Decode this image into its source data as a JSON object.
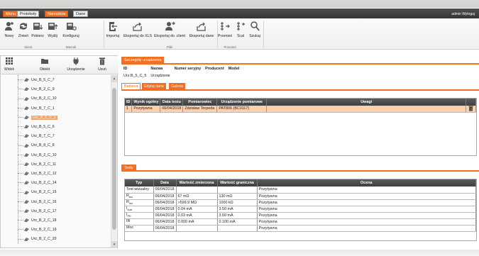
{
  "menubar": {
    "tabs": [
      {
        "label": "Menu",
        "active": true
      },
      {
        "label": "Protokoły",
        "active": false
      },
      {
        "label": "Narzędzia",
        "active": true
      },
      {
        "label": "Dane",
        "active": false
      }
    ],
    "admin_user": "admin",
    "logout": "Wyloguj"
  },
  "ribbon": {
    "buttons": {
      "nowy": "Nowy",
      "zmien": "Zmień",
      "pobierz": "Pobierz",
      "wyslij": "Wyślij",
      "konfiguruj": "Konfiguruj",
      "importuj": "Importuj",
      "eksport_xls": "Eksportuj do XLS",
      "eksport_client": "Eksportuj do .client",
      "eksport_dane": "Eksportuj dane",
      "przenies": "Przenieś",
      "scal": "Scal",
      "szukaj": "Szukaj"
    },
    "groups": {
      "klient": "Klient",
      "miernik": "Miernik",
      "pliki": "Pliki",
      "przenies": "Przenieś"
    }
  },
  "left_panel": {
    "tools": {
      "widok": "Widok",
      "obiekt": "Obiekt",
      "urzadzenie": "Urządzenie",
      "usun": "Usuń"
    },
    "tree_items": [
      "Urz_B_5_C_7",
      "Urz_B_2_C_9",
      "Urz_B_2_C_10",
      "Urz_B_7_C_1",
      "Urz_B_5_C_5",
      "Urz_B_5_C_6",
      "Urz_B_7_C_7",
      "Urz_B_8_C_8",
      "Urz_B_2_C_10",
      "Urz_B_2_C_11",
      "Urz_B_2_C_12",
      "Urz_B_2_C_14",
      "Urz_B_2_C_15",
      "Urz_B_2_C_16",
      "Urz_B_2_C_17",
      "Urz_B_2_C_18",
      "Urz_B_2_C_19",
      "Urz_B_2_C_20"
    ],
    "selected_index": 4
  },
  "details": {
    "header": "Szczegóły urządzenia",
    "columns": [
      "ID",
      "Nazwa",
      "Numer seryjny",
      "Producent",
      "Model"
    ],
    "values": [
      "Urz.B_5_C_5",
      "Urządzenie",
      "",
      "",
      ""
    ]
  },
  "subtabs": [
    "Badania",
    "Edytuj dane",
    "Galeria"
  ],
  "badania": {
    "columns": [
      "ID",
      "Wynik ogólny",
      "Data testu",
      "Pomiarowiec",
      "Urządzenie pomiarowe",
      "Uwagi"
    ],
    "rows": [
      [
        "1",
        "Pozytywna",
        "06/04/2018",
        "Zdzisław Torpeda",
        "PAT806 (BC0117)",
        ""
      ]
    ]
  },
  "testy": {
    "header": "Testy",
    "columns": [
      "Typ",
      "Data",
      "Wartość zmierzona",
      "Wartość graniczna",
      "Ocena"
    ],
    "rows": [
      {
        "typ": "Test wizualny",
        "sub": "",
        "data": "06/04/2018",
        "zmierzona": "",
        "graniczna": "",
        "ocena": "Pozytywna"
      },
      {
        "typ": "R",
        "sub": "iso",
        "data": "06/04/2018",
        "zmierzona": "67 mΩ",
        "graniczna": "130 mΩ",
        "ocena": "Pozytywna"
      },
      {
        "typ": "R",
        "sub": "iso",
        "data": "06/04/2018",
        "zmierzona": ">599.9 MΩ",
        "graniczna": "1000 kΩ",
        "ocena": "Pozytywna"
      },
      {
        "typ": "I",
        "sub": "sub",
        "data": "06/04/2018",
        "zmierzona": "0.04 mA",
        "graniczna": "3.50 mA",
        "ocena": "Pozytywna"
      },
      {
        "typ": "I",
        "sub": "PE",
        "data": "06/04/2018",
        "zmierzona": "0.03 mA",
        "graniczna": "3.50 mA",
        "ocena": "Pozytywna"
      },
      {
        "typ": "IR",
        "sub": "",
        "data": "06/04/2018",
        "zmierzona": "0.000 mA",
        "graniczna": "0.100 mA",
        "ocena": "Pozytywna"
      },
      {
        "typ": "Moc",
        "sub": "",
        "data": "06/04/2018",
        "zmierzona": "",
        "graniczna": "",
        "ocena": "Pozytywna"
      }
    ]
  },
  "colors": {
    "accent": "#f36f21",
    "header_dark": "#3f3f3f",
    "selection": "#fbd0b0"
  }
}
